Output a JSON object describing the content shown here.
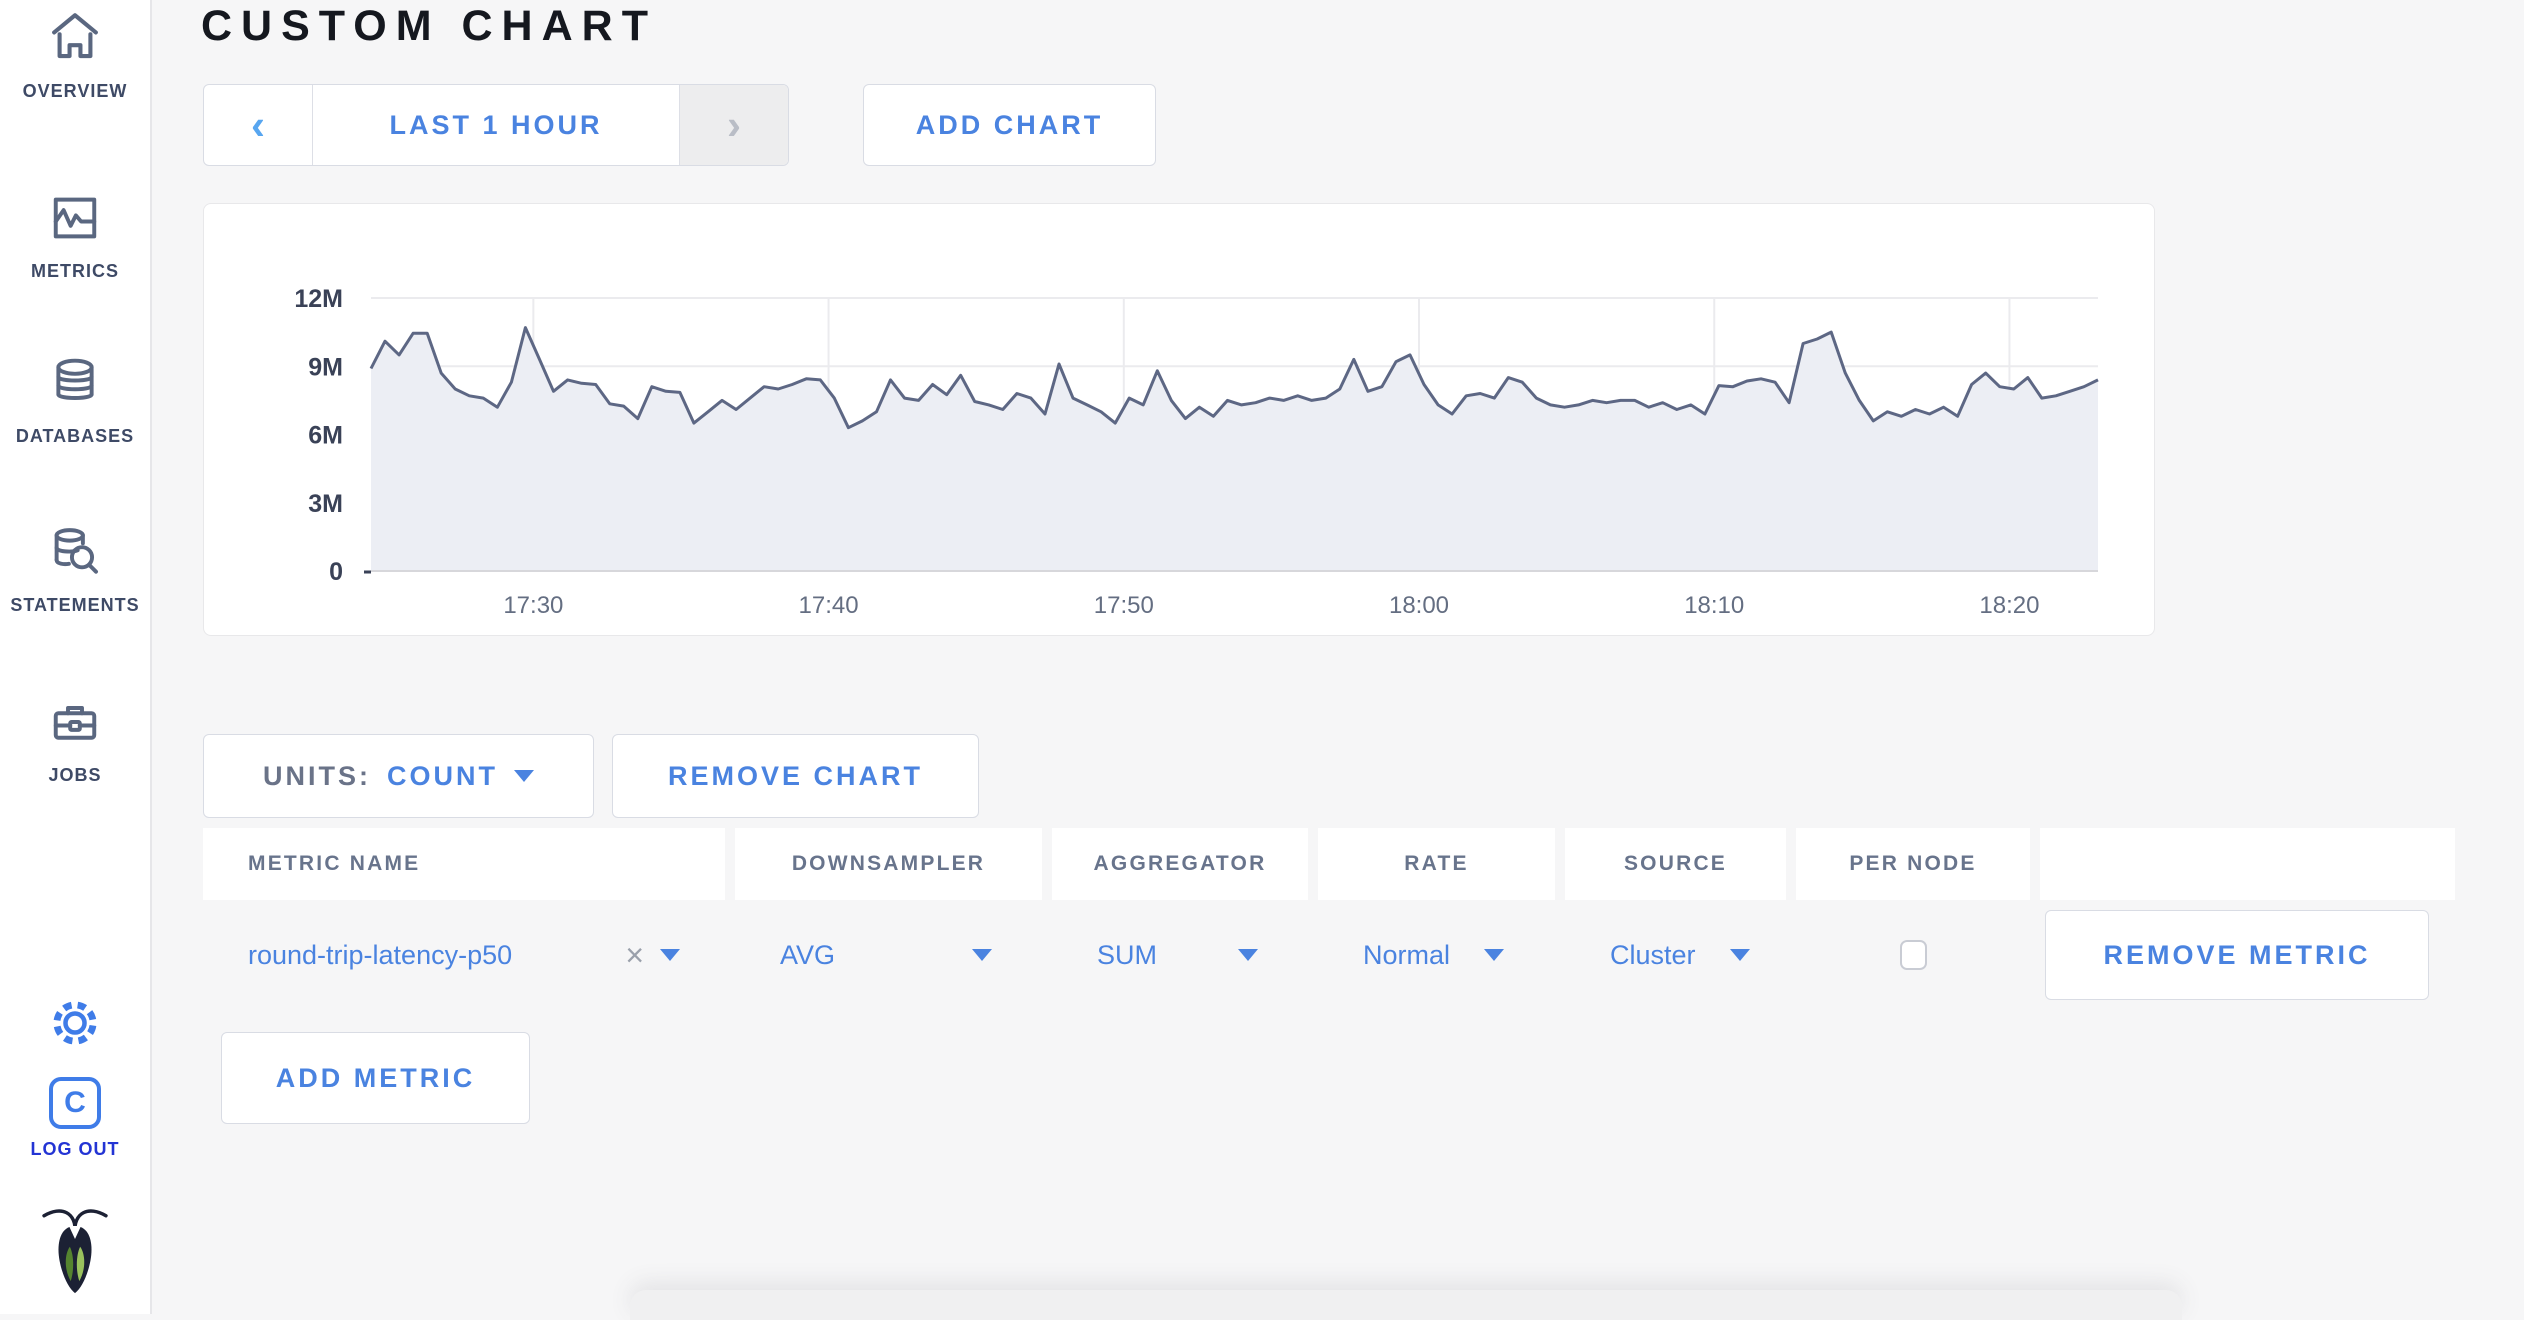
{
  "sidebar": {
    "items": [
      {
        "label": "OVERVIEW",
        "icon": "home-icon"
      },
      {
        "label": "METRICS",
        "icon": "metrics-icon"
      },
      {
        "label": "DATABASES",
        "icon": "database-icon"
      },
      {
        "label": "STATEMENTS",
        "icon": "statements-icon"
      },
      {
        "label": "JOBS",
        "icon": "jobs-icon"
      }
    ],
    "logout_label": "LOG OUT",
    "logo_letter": "C"
  },
  "header": {
    "title": "CUSTOM CHART"
  },
  "controls": {
    "time_range_label": "LAST 1 HOUR",
    "prev_icon": "‹",
    "next_icon": "›",
    "add_chart_label": "ADD CHART"
  },
  "chart_toolbar": {
    "units_label": "UNITS:",
    "units_value": "COUNT",
    "remove_chart_label": "REMOVE CHART"
  },
  "metrics_table": {
    "columns": [
      "METRIC NAME",
      "DOWNSAMPLER",
      "AGGREGATOR",
      "RATE",
      "SOURCE",
      "PER NODE"
    ],
    "close_icon": "×",
    "rows": [
      {
        "metric_name": "round-trip-latency-p50",
        "downsampler": "AVG",
        "aggregator": "SUM",
        "rate": "Normal",
        "source": "Cluster",
        "per_node_checked": false,
        "remove_label": "REMOVE METRIC"
      }
    ],
    "add_metric_label": "ADD METRIC"
  },
  "chart_data": {
    "type": "area",
    "title": "",
    "unit": "count",
    "ylim_millions": [
      0,
      12
    ],
    "x_start_min": 1044.5,
    "x_end_min": 1103,
    "grid": true,
    "y_ticks": [
      {
        "value_millions": 0,
        "label": "0"
      },
      {
        "value_millions": 3,
        "label": "3M"
      },
      {
        "value_millions": 6,
        "label": "6M"
      },
      {
        "value_millions": 9,
        "label": "9M"
      },
      {
        "value_millions": 12,
        "label": "12M"
      }
    ],
    "x_ticks": [
      {
        "min": 1050,
        "label": "17:30"
      },
      {
        "min": 1060,
        "label": "17:40"
      },
      {
        "min": 1070,
        "label": "17:50"
      },
      {
        "min": 1080,
        "label": "18:00"
      },
      {
        "min": 1090,
        "label": "18:10"
      },
      {
        "min": 1100,
        "label": "18:20"
      }
    ],
    "series": [
      {
        "name": "round-trip-latency-p50",
        "values_millions": [
          8.9,
          10.1,
          9.5,
          10.45,
          10.45,
          8.7,
          8.0,
          7.7,
          7.6,
          7.2,
          8.3,
          10.7,
          9.3,
          7.9,
          8.4,
          8.25,
          8.2,
          7.35,
          7.25,
          6.7,
          8.1,
          7.9,
          7.85,
          6.5,
          7.0,
          7.5,
          7.1,
          7.6,
          8.1,
          8.0,
          8.2,
          8.45,
          8.4,
          7.6,
          6.3,
          6.6,
          7.0,
          8.4,
          7.6,
          7.5,
          8.2,
          7.75,
          8.6,
          7.45,
          7.3,
          7.1,
          7.8,
          7.6,
          6.9,
          9.1,
          7.6,
          7.3,
          7.0,
          6.5,
          7.6,
          7.3,
          8.8,
          7.5,
          6.7,
          7.2,
          6.8,
          7.5,
          7.3,
          7.4,
          7.6,
          7.5,
          7.7,
          7.5,
          7.6,
          8.0,
          9.3,
          7.9,
          8.1,
          9.2,
          9.5,
          8.2,
          7.3,
          6.9,
          7.7,
          7.8,
          7.6,
          8.5,
          8.3,
          7.6,
          7.3,
          7.2,
          7.3,
          7.5,
          7.4,
          7.5,
          7.5,
          7.2,
          7.4,
          7.1,
          7.3,
          6.9,
          8.15,
          8.1,
          8.35,
          8.45,
          8.3,
          7.4,
          10.0,
          10.2,
          10.5,
          8.7,
          7.5,
          6.6,
          7.0,
          6.8,
          7.1,
          6.9,
          7.2,
          6.8,
          8.2,
          8.7,
          8.1,
          8.0,
          8.5,
          7.6,
          7.7,
          7.9,
          8.1,
          8.4
        ]
      }
    ],
    "colors": {
      "line": "#5d6784",
      "fill": "#eceef4",
      "grid": "#ebebee"
    }
  },
  "colors": {
    "accent_blue": "#4a83e0",
    "slate": "#5a6780",
    "logout_blue": "#2334d4",
    "page_bg": "#f6f6f7"
  }
}
